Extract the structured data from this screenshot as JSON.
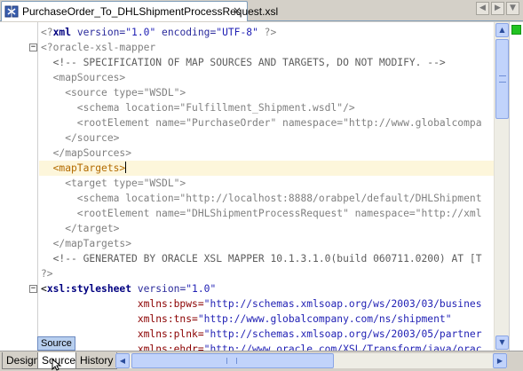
{
  "tab": {
    "title": "PurchaseOrder_To_DHLShipmentProcessRequest.xsl",
    "close_glyph": "×",
    "nav_left": "◀",
    "nav_right": "▶",
    "nav_menu": "▼"
  },
  "editor": {
    "lines": [
      [
        {
          "t": "<?",
          "c": "c-pi"
        },
        {
          "t": "xml",
          "c": "c-kw"
        },
        {
          "t": " version=",
          "c": "c-attr"
        },
        {
          "t": "\"1.0\"",
          "c": "c-val"
        },
        {
          "t": " encoding=",
          "c": "c-attr"
        },
        {
          "t": "\"UTF-8\"",
          "c": "c-val"
        },
        {
          "t": " ?>",
          "c": "c-pi"
        }
      ],
      [
        {
          "t": "<?oracle-xsl-mapper",
          "c": "c-pi"
        }
      ],
      [
        {
          "t": "  <!-- SPECIFICATION OF MAP SOURCES AND TARGETS, DO NOT MODIFY. -->",
          "c": "c-comment"
        }
      ],
      [
        {
          "t": "  <mapSources>",
          "c": "c-pi"
        }
      ],
      [
        {
          "t": "    <source type=\"WSDL\">",
          "c": "c-pi"
        }
      ],
      [
        {
          "t": "      <schema location=\"Fulfillment_Shipment.wsdl\"/>",
          "c": "c-pi"
        }
      ],
      [
        {
          "t": "      <rootElement name=\"PurchaseOrder\" namespace=\"http://www.globalcompa",
          "c": "c-pi"
        }
      ],
      [
        {
          "t": "    </source>",
          "c": "c-pi"
        }
      ],
      [
        {
          "t": "  </mapSources>",
          "c": "c-pi"
        }
      ],
      [
        {
          "t": "  <mapTargets>",
          "c": "c-tag"
        }
      ],
      [
        {
          "t": "    <target type=\"WSDL\">",
          "c": "c-pi"
        }
      ],
      [
        {
          "t": "      <schema location=\"http://localhost:8888/orabpel/default/DHLShipment",
          "c": "c-pi"
        }
      ],
      [
        {
          "t": "      <rootElement name=\"DHLShipmentProcessRequest\" namespace=\"http://xml",
          "c": "c-pi"
        }
      ],
      [
        {
          "t": "    </target>",
          "c": "c-pi"
        }
      ],
      [
        {
          "t": "  </mapTargets>",
          "c": "c-pi"
        }
      ],
      [
        {
          "t": "  <!-- GENERATED BY ORACLE XSL MAPPER 10.1.3.1.0(build 060711.0200) AT [T",
          "c": "c-comment"
        }
      ],
      [
        {
          "t": "?>",
          "c": "c-pi"
        }
      ],
      [
        {
          "t": "<",
          "c": "c-plain"
        },
        {
          "t": "xsl:stylesheet",
          "c": "c-kw"
        },
        {
          "t": " version=",
          "c": "c-attr"
        },
        {
          "t": "\"1.0\"",
          "c": "c-val"
        }
      ],
      [
        {
          "t": "                xmlns:bpws=",
          "c": "c-ns"
        },
        {
          "t": "\"http://schemas.xmlsoap.org/ws/2003/03/busines",
          "c": "c-val"
        }
      ],
      [
        {
          "t": "                xmlns:tns=",
          "c": "c-ns"
        },
        {
          "t": "\"http://www.globalcompany.com/ns/shipment\"",
          "c": "c-val"
        }
      ],
      [
        {
          "t": "                xmlns:plnk=",
          "c": "c-ns"
        },
        {
          "t": "\"http://schemas.xmlsoap.org/ws/2003/05/partner",
          "c": "c-val"
        }
      ],
      [
        {
          "t": "                xmlns:ehdr=",
          "c": "c-ns"
        },
        {
          "t": "\"http://www.oracle.com/XSL/Transform/java/orac",
          "c": "c-val"
        }
      ]
    ],
    "fold_markers": [
      {
        "line": 1,
        "glyph": "−"
      },
      {
        "line": 17,
        "glyph": "−"
      }
    ],
    "current_line": 9
  },
  "scroll": {
    "up": "▲",
    "down": "▼",
    "left": "◀",
    "right": "▶"
  },
  "bottom_tabs": [
    "Design",
    "Source",
    "History"
  ],
  "active_bottom_tab": "Source",
  "tooltip": "Source"
}
